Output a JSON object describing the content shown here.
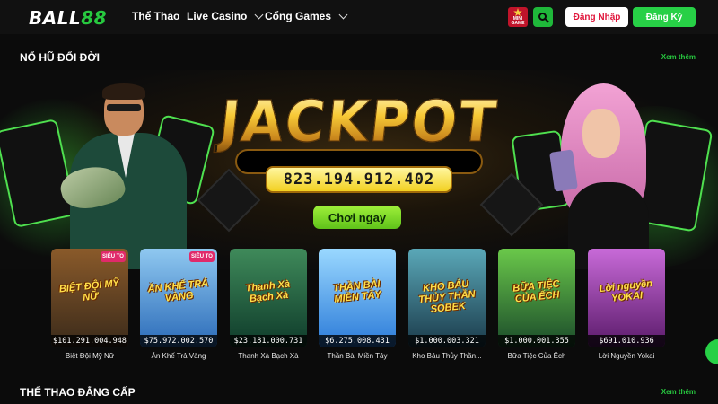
{
  "nav": {
    "logo_main": "BALL",
    "logo_num": "88",
    "links": [
      {
        "label": "Thể Thao"
      },
      {
        "label": "Live Casino"
      },
      {
        "label": "Cổng Games"
      }
    ],
    "mini_game_line1": "MINI",
    "mini_game_line2": "GAME",
    "login_label": "Đăng Nhập",
    "register_label": "Đăng Ký"
  },
  "sections": {
    "jackpot_title": "NỔ HŨ ĐỔI ĐỜI",
    "sports_title": "THỂ THAO ĐẲNG CẤP",
    "see_more": "Xem thêm"
  },
  "banner": {
    "title": "JACKPOT",
    "value": "823.194.912.402",
    "cta": "Chơi ngay"
  },
  "games": [
    {
      "label": "Biệt Đội Mỹ Nữ",
      "art": "BIỆT ĐỘI MỸ NỮ",
      "amount": "$101.291.004.948",
      "tag": "SIÊU TO",
      "bg1": "#3a2a1a",
      "bg2": "#8a5a2a"
    },
    {
      "label": "Ăn Khế Trả Vàng",
      "art": "ĂN KHẾ TRẢ VÀNG",
      "amount": "$75.972.002.570",
      "tag": "SIÊU TO",
      "bg1": "#2a6ab8",
      "bg2": "#8fc8f0"
    },
    {
      "label": "Thanh Xà Bạch Xà",
      "art": "Thanh Xà Bạch Xà",
      "amount": "$23.181.000.731",
      "tag": "",
      "bg1": "#0e3a2a",
      "bg2": "#3f8a5a"
    },
    {
      "label": "Thần Bài Miền Tây",
      "art": "THẦN BÀI MIỀN TÂY",
      "amount": "$6.275.008.431",
      "tag": "",
      "bg1": "#2a7ad8",
      "bg2": "#9ad8ff"
    },
    {
      "label": "Kho Báu Thủy Thần...",
      "art": "KHO BÁU THỦY THẦN SOBEK",
      "amount": "$1.000.003.321",
      "tag": "",
      "bg1": "#1a3a4a",
      "bg2": "#5aa8b8"
    },
    {
      "label": "Bữa Tiệc Của Ếch",
      "art": "BỮA TIỆC CỦA ẾCH",
      "amount": "$1.000.001.355",
      "tag": "",
      "bg1": "#1a4a2a",
      "bg2": "#6ac84a"
    },
    {
      "label": "Lời Nguyền Yokai",
      "art": "Lời nguyền YOKAI",
      "amount": "$691.010.936",
      "tag": "",
      "bg1": "#5a1a6a",
      "bg2": "#c86ad8"
    }
  ]
}
